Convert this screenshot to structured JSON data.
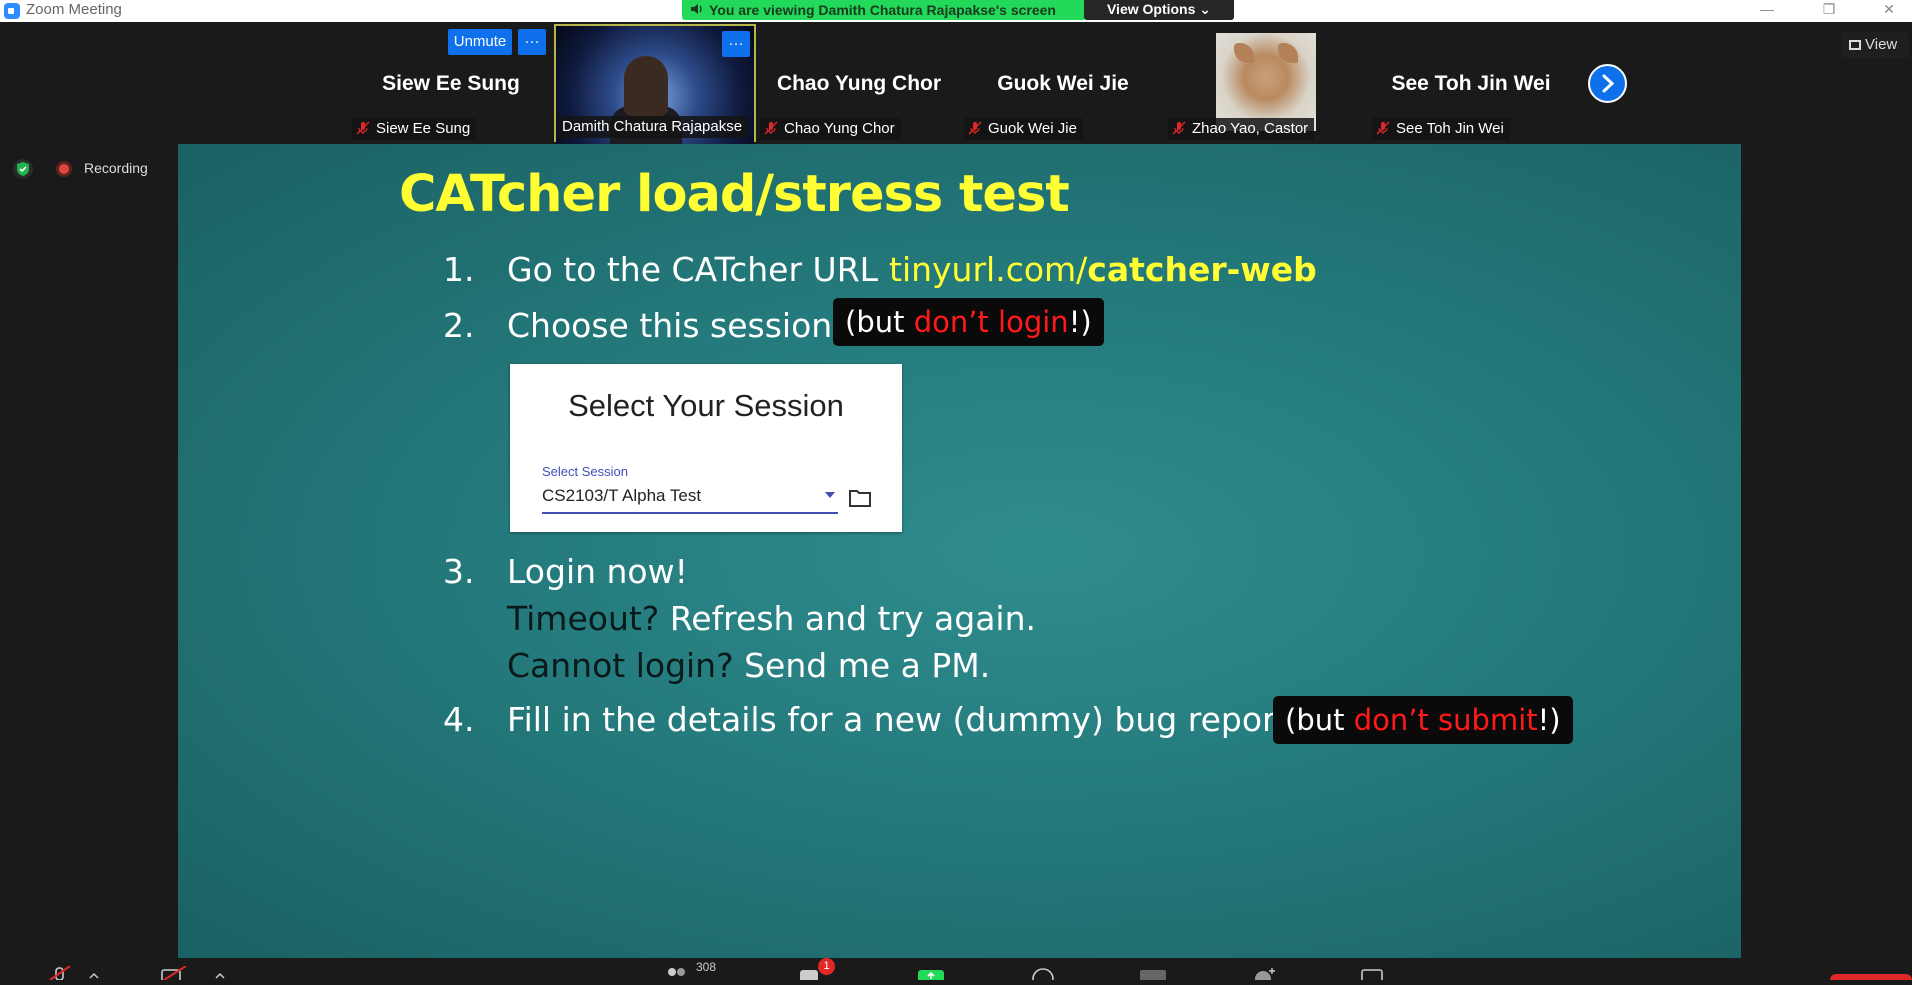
{
  "window": {
    "title": "Zoom Meeting",
    "minimize": "—",
    "restore": "❐",
    "close": "✕"
  },
  "banner": {
    "text": "You are viewing Damith Chatura Rajapakse's screen",
    "view_options": "View Options ⌄"
  },
  "strip": {
    "tiles": [
      {
        "big_name": "Siew Ee Sung",
        "label": "Siew Ee Sung"
      },
      {
        "big_name": "",
        "label": "Damith Chatura Rajapakse"
      },
      {
        "big_name": "Chao Yung Chor",
        "label": "Chao Yung Chor"
      },
      {
        "big_name": "Guok Wei Jie",
        "label": "Guok Wei Jie"
      },
      {
        "big_name": "",
        "label": "Zhao Yao, Castor"
      },
      {
        "big_name": "See Toh Jin Wei",
        "label": "See Toh Jin Wei"
      }
    ],
    "unmute_label": "Unmute",
    "more_label": "···",
    "view_label": "View"
  },
  "status": {
    "recording": "Recording"
  },
  "slide": {
    "title": "CATcher load/stress test",
    "steps": [
      {
        "num": "1.",
        "text": "Go to the CATcher URL",
        "url_plain": "tinyurl.com/",
        "url_bold": "catcher-web"
      },
      {
        "num": "2.",
        "text": "Choose this session",
        "pill_open": "(but ",
        "pill_red": "don’t login",
        "pill_close": "!)"
      },
      {
        "num": "3.",
        "line1": "Login now!",
        "line2_dark": "Timeout?",
        "line2_rest": " Refresh and try again.",
        "line3_dark": "Cannot login?",
        "line3_rest": " Send me a PM."
      },
      {
        "num": "4.",
        "text": "Fill in the details for a new (dummy) bug report.",
        "pill_open": "(but ",
        "pill_red": "don’t submit",
        "pill_close": "!)"
      }
    ],
    "session_box": {
      "header": "Select Your Session",
      "field_label": "Select Session",
      "field_value": "CS2103/T Alpha Test"
    }
  },
  "toolbar": {
    "participants_count": "308",
    "chat_badge": "1"
  },
  "colors": {
    "slide_bg": "#247a7c",
    "title_yellow": "#ffff33",
    "alert_red": "#ff1a1a",
    "zoom_blue": "#0e71eb",
    "banner_green": "#23d959"
  }
}
